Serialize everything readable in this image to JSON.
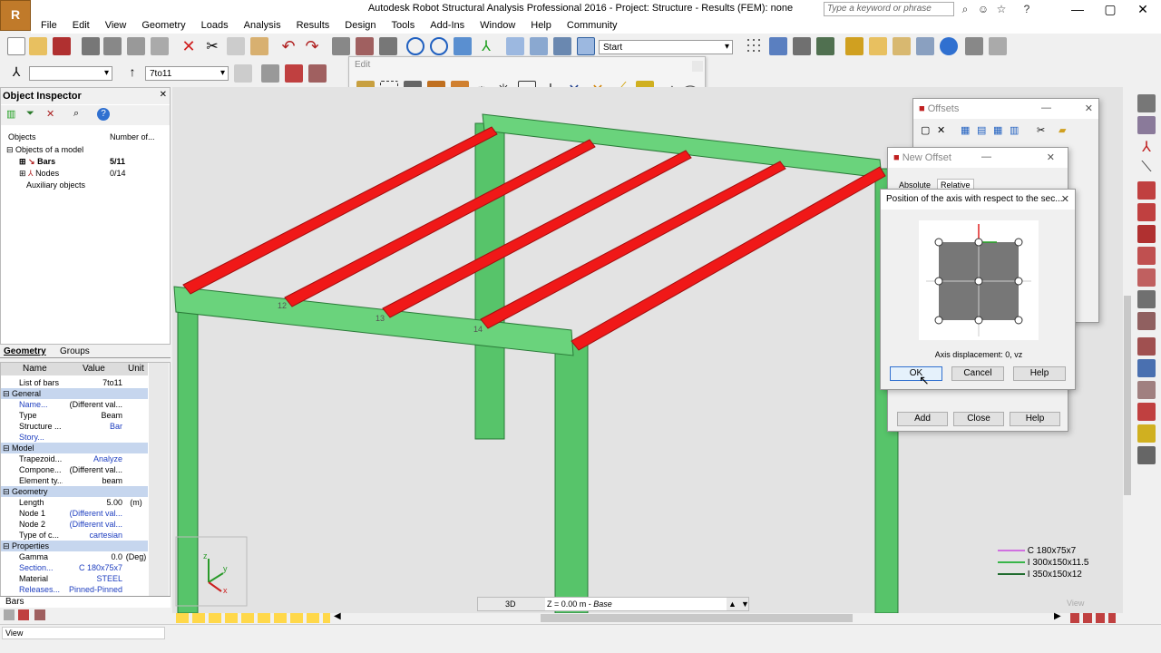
{
  "app": {
    "title": "Autodesk Robot Structural Analysis Professional 2016 - Project: Structure - Results (FEM): none",
    "logo_text": "R",
    "search_placeholder": "Type a keyword or phrase"
  },
  "menu": [
    "File",
    "Edit",
    "View",
    "Geometry",
    "Loads",
    "Analysis",
    "Results",
    "Design",
    "Tools",
    "Add-Ins",
    "Window",
    "Help",
    "Community"
  ],
  "toolbar": {
    "layout_combo": "Start",
    "bar_selection": "7to11",
    "node_selection": ""
  },
  "edit_toolbar": {
    "title": "Edit"
  },
  "object_inspector": {
    "title": "Object Inspector",
    "columns": [
      "Objects",
      "Number of..."
    ],
    "tree": [
      {
        "label": "Objects of a model",
        "count": ""
      },
      {
        "label": "Bars",
        "count": "5/11"
      },
      {
        "label": "Nodes",
        "count": "0/14"
      },
      {
        "label": "Auxiliary objects",
        "count": ""
      }
    ],
    "tabs": [
      "Geometry",
      "Groups"
    ]
  },
  "properties": {
    "headers": [
      "Name",
      "Value",
      "Unit"
    ],
    "rows": [
      {
        "n": "List of bars",
        "v": "7to11",
        "u": "",
        "t": "row"
      },
      {
        "n": "General",
        "t": "sect"
      },
      {
        "n": "Name...",
        "v": "(Different val...",
        "u": "",
        "t": "row",
        "blue": true
      },
      {
        "n": "Type",
        "v": "Beam",
        "u": "",
        "t": "row"
      },
      {
        "n": "Structure ...",
        "v": "Bar",
        "u": "",
        "t": "row",
        "vblue": true
      },
      {
        "n": "Story...",
        "v": "",
        "u": "",
        "t": "row",
        "blue": true
      },
      {
        "n": "Model",
        "t": "sect"
      },
      {
        "n": "Trapezoid...",
        "v": "Analyze",
        "u": "",
        "t": "row",
        "vblue": true
      },
      {
        "n": "Compone...",
        "v": "(Different val...",
        "u": "",
        "t": "row"
      },
      {
        "n": "Element ty...",
        "v": "beam",
        "u": "",
        "t": "row"
      },
      {
        "n": "Geometry",
        "t": "sect"
      },
      {
        "n": "Length",
        "v": "5.00",
        "u": "(m)",
        "t": "row"
      },
      {
        "n": "Node 1",
        "v": "(Different val...",
        "u": "",
        "t": "row",
        "vblue": true
      },
      {
        "n": "Node 2",
        "v": "(Different val...",
        "u": "",
        "t": "row",
        "vblue": true
      },
      {
        "n": "Type of c...",
        "v": "cartesian",
        "u": "",
        "t": "row",
        "vblue": true
      },
      {
        "n": "Properties",
        "t": "sect"
      },
      {
        "n": "Gamma",
        "v": "0.0",
        "u": "(Deg)",
        "t": "row"
      },
      {
        "n": "Section...",
        "v": "C 180x75x7",
        "u": "",
        "t": "row",
        "blue": true,
        "vblue": true
      },
      {
        "n": "Material",
        "v": "STEEL",
        "u": "",
        "t": "row",
        "vblue": true
      },
      {
        "n": "Releases...",
        "v": "Pinned-Pinned",
        "u": "",
        "t": "row",
        "blue": true,
        "vblue": true
      }
    ],
    "bottom_tab": "Bars"
  },
  "viewport": {
    "node_labels": [
      "12",
      "13",
      "14"
    ],
    "view_mode": "3D",
    "plane": "Z = 0.00 m",
    "plane_name": "Base",
    "corner_label": "View",
    "legend": [
      {
        "label": "C 180x75x7",
        "color": "#d070e0"
      },
      {
        "label": "I 300x150x11.5",
        "color": "#39b54a"
      },
      {
        "label": "I 350x150x12",
        "color": "#1f6b2e"
      }
    ]
  },
  "offsets_dialog": {
    "title": "Offsets"
  },
  "new_offset_dialog": {
    "title": "New Offset",
    "tabs": [
      "Absolute",
      "Relative"
    ],
    "buttons": [
      "Add",
      "Close",
      "Help"
    ]
  },
  "axis_dialog": {
    "title": "Position of the axis with respect to the sec...",
    "displacement": "Axis displacement:  0, vz",
    "buttons": [
      "OK",
      "Cancel",
      "Help"
    ]
  },
  "status": {
    "text": "View"
  }
}
